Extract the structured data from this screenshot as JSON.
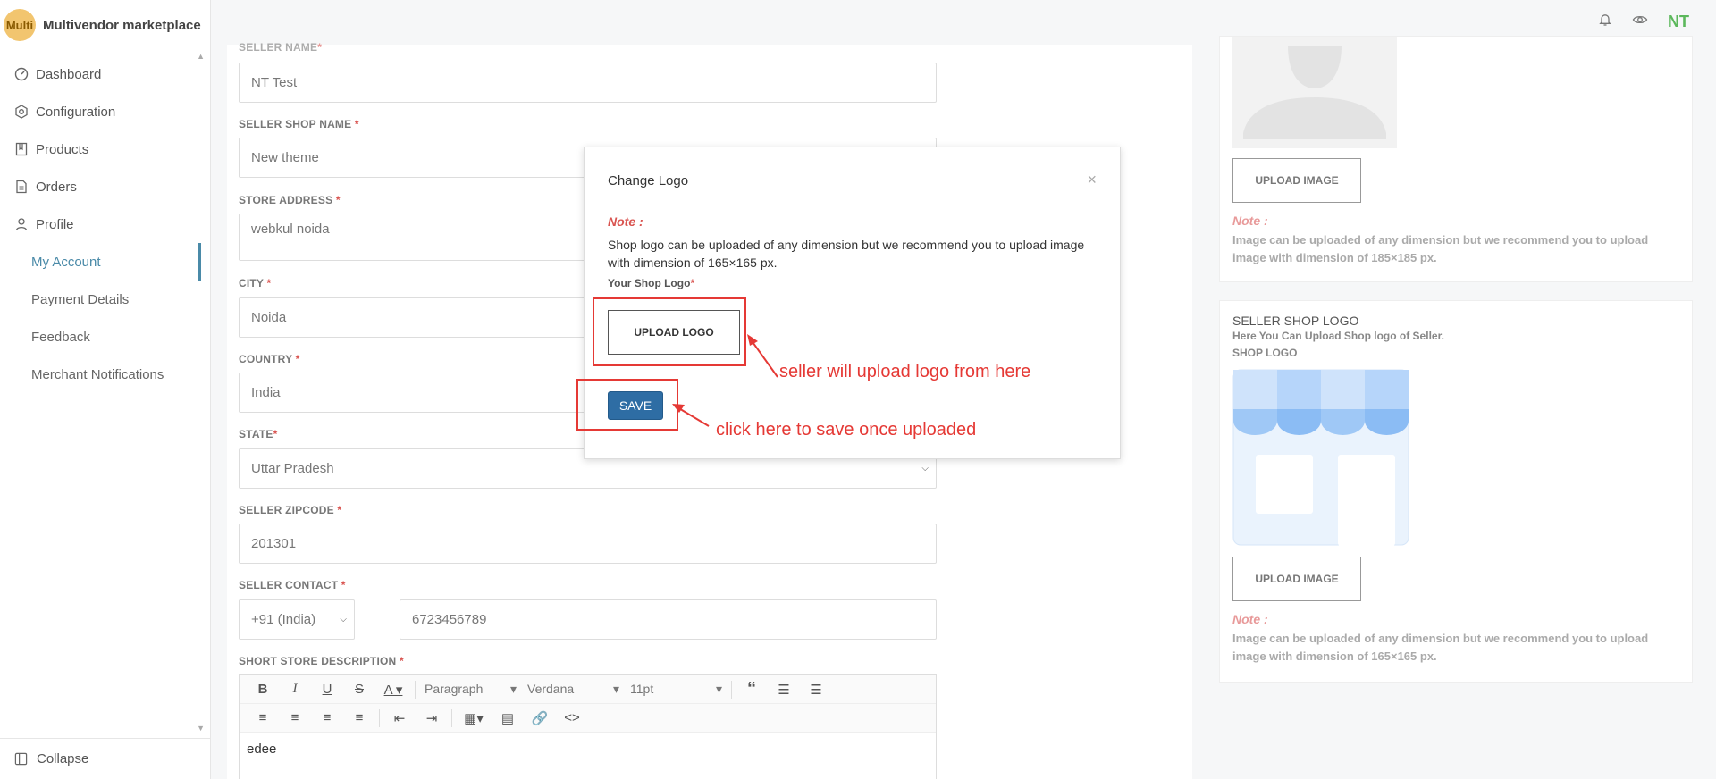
{
  "brand": {
    "logo_text": "Multi",
    "name": "Multivendor marketplace"
  },
  "sidebar": {
    "items": [
      {
        "label": "Dashboard",
        "icon": "dashboard-icon"
      },
      {
        "label": "Configuration",
        "icon": "hexagon-gear-icon"
      },
      {
        "label": "Products",
        "icon": "book-icon"
      },
      {
        "label": "Orders",
        "icon": "file-icon"
      },
      {
        "label": "Profile",
        "icon": "user-icon"
      }
    ],
    "subitems": [
      {
        "label": "My Account",
        "active": true
      },
      {
        "label": "Payment Details"
      },
      {
        "label": "Feedback"
      },
      {
        "label": "Merchant Notifications"
      }
    ],
    "collapse_label": "Collapse"
  },
  "topbar": {
    "avatar": "NT",
    "icons": [
      "bell-icon",
      "eye-icon"
    ]
  },
  "form": {
    "seller_name_label": "SELLER NAME",
    "seller_name": "NT Test",
    "shop_name_label": "SELLER SHOP NAME",
    "shop_name": "New theme",
    "address_label": "STORE ADDRESS",
    "address": "webkul noida",
    "city_label": "CITY",
    "city": "Noida",
    "country_label": "COUNTRY",
    "country": "India",
    "state_label": "STATE",
    "state": "Uttar Pradesh",
    "zip_label": "SELLER ZIPCODE",
    "zip": "201301",
    "contact_label": "SELLER CONTACT",
    "country_code": "+91 (India)",
    "phone": "6723456789",
    "desc_label": "SHORT STORE DESCRIPTION",
    "desc_content": "edee",
    "required_mark": "*"
  },
  "editor": {
    "paragraph": "Paragraph",
    "font": "Verdana",
    "size": "11pt"
  },
  "right": {
    "upload_image": "UPLOAD IMAGE",
    "note_title": "Note :",
    "banner_note": "Image can be uploaded of any dimension but we recommend you to upload image with dimension of 185×185 px.",
    "logo_section_title": "SELLER SHOP LOGO",
    "logo_section_subtitle": "Here You Can Upload Shop logo of Seller.",
    "logo_label": "SHOP LOGO",
    "logo_note": "Image can be uploaded of any dimension but we recommend you to upload image with dimension of 165×165 px."
  },
  "modal": {
    "title": "Change Logo",
    "close": "×",
    "note_title": "Note :",
    "note_text": "Shop logo can be uploaded of any dimension but we recommend you to upload image with dimension of 165×165 px.",
    "your_logo_label": "Your Shop Logo",
    "upload_button": "UPLOAD LOGO",
    "save_button": "SAVE"
  },
  "annotations": {
    "upload": "seller will upload logo from here",
    "save": "click here to save once uploaded"
  }
}
